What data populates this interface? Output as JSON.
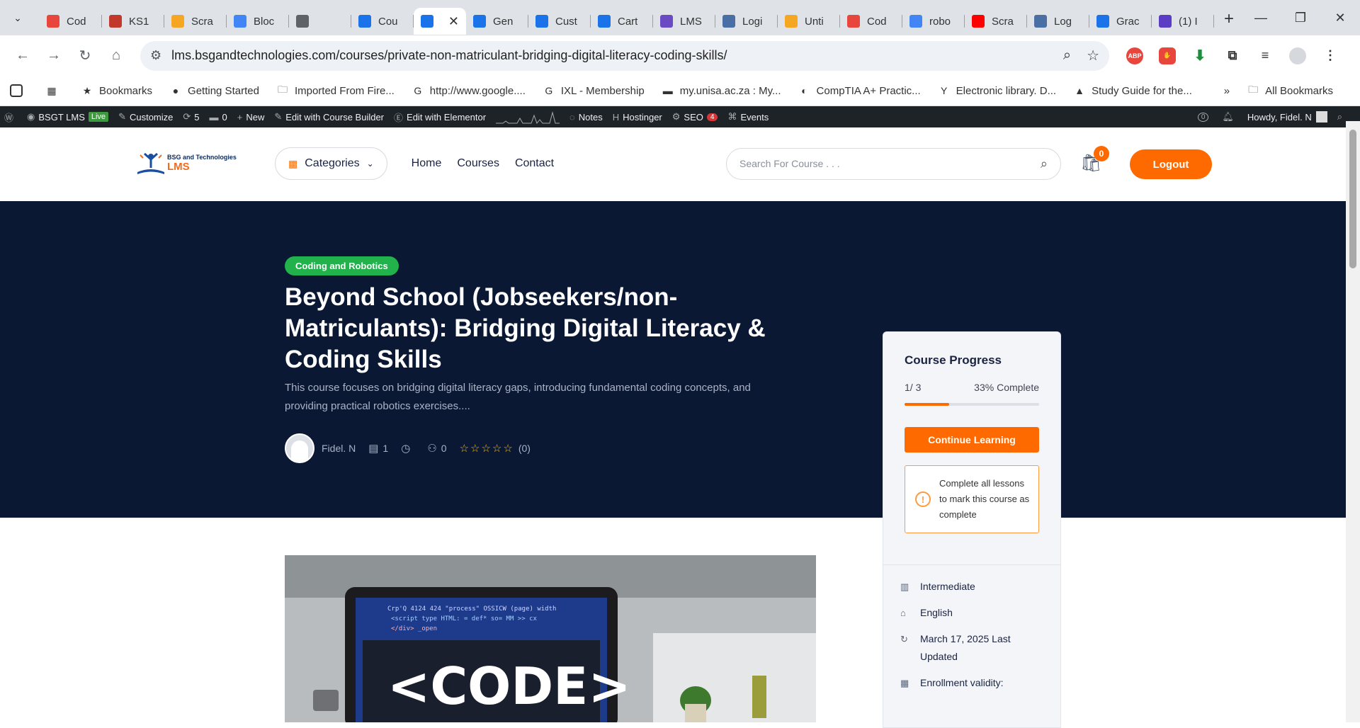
{
  "browser": {
    "tabs": [
      {
        "label": "Cod",
        "color": "#e8453c"
      },
      {
        "label": "KS1",
        "color": "#c0392b"
      },
      {
        "label": "Scra",
        "color": "#f5a623"
      },
      {
        "label": "Bloc",
        "color": "#4285f4"
      },
      {
        "label": "",
        "color": "#5f6368"
      },
      {
        "label": "Cou",
        "color": "#1a73e8"
      },
      {
        "label": "",
        "color": "#1a73e8",
        "active": true
      },
      {
        "label": "Gen",
        "color": "#1a73e8"
      },
      {
        "label": "Cust",
        "color": "#1a73e8"
      },
      {
        "label": "Cart",
        "color": "#1a73e8"
      },
      {
        "label": "LMS",
        "color": "#6a4bc4"
      },
      {
        "label": "Logi",
        "color": "#4a6fa5"
      },
      {
        "label": "Unti",
        "color": "#f5a623"
      },
      {
        "label": "Cod",
        "color": "#e8453c"
      },
      {
        "label": "robo",
        "color": "#4285f4"
      },
      {
        "label": "Scra",
        "color": "#ff0000"
      },
      {
        "label": "Log",
        "color": "#4a6fa5"
      },
      {
        "label": "Grac",
        "color": "#1a73e8"
      },
      {
        "label": "(1) I",
        "color": "#5b3cc4"
      }
    ],
    "url": "lms.bsgandtechnologies.com/courses/private-non-matriculant-bridging-digital-literacy-coding-skills/",
    "bookmarks": [
      {
        "label": "Bookmarks",
        "icon": "star-icon"
      },
      {
        "label": "Getting Started",
        "icon": "firefox-icon"
      },
      {
        "label": "Imported From Fire...",
        "icon": "folder-icon"
      },
      {
        "label": "http://www.google....",
        "icon": "google-icon"
      },
      {
        "label": "IXL - Membership",
        "icon": "google-icon"
      },
      {
        "label": "my.unisa.ac.za : My...",
        "icon": "unisa-icon"
      },
      {
        "label": "CompTIA A+ Practic...",
        "icon": "comptia-icon"
      },
      {
        "label": "Electronic library. D...",
        "icon": "library-icon"
      },
      {
        "label": "Study Guide for the...",
        "icon": "study-icon"
      }
    ],
    "all_bookmarks": "All Bookmarks",
    "ext_abp": "ABP"
  },
  "wpbar": {
    "site": "BSGT LMS",
    "live": "Live",
    "customize": "Customize",
    "updates": "5",
    "comments": "0",
    "new": "New",
    "course_builder": "Edit with Course Builder",
    "elementor": "Edit with Elementor",
    "notes": "Notes",
    "hostinger": "Hostinger",
    "seo": "SEO",
    "seo_count": "4",
    "events": "Events",
    "notif_count": "0",
    "howdy": "Howdy, Fidel. N"
  },
  "site": {
    "logo_top": "BSG and Technologies",
    "logo_lms": "LMS",
    "categories": "Categories",
    "nav": [
      "Home",
      "Courses",
      "Contact"
    ],
    "search_placeholder": "Search For Course . . .",
    "cart_count": "0",
    "logout": "Logout"
  },
  "course": {
    "category": "Coding and Robotics",
    "title": "Beyond School (Jobseekers/non-Matriculants): Bridging Digital Literacy & Coding Skills",
    "description": "This course focuses on bridging digital literacy gaps, introducing fundamental coding concepts, and providing practical robotics exercises....",
    "author": "Fidel. N",
    "lessons": "1",
    "students": "0",
    "stars": "☆☆☆☆☆",
    "rating_count": "(0)",
    "image_text": "<CODE>"
  },
  "progress": {
    "title": "Course Progress",
    "fraction": "1/ 3",
    "percent_text": "33% Complete",
    "percent": 33,
    "continue": "Continue Learning",
    "notice": "Complete all lessons to mark this course as complete"
  },
  "info": {
    "level": "Intermediate",
    "language": "English",
    "updated": "March 17, 2025 Last Updated",
    "validity": "Enrollment validity:"
  },
  "colors": {
    "accent": "#ff6a00",
    "hero": "#0a1833",
    "pill": "#22b24c"
  }
}
